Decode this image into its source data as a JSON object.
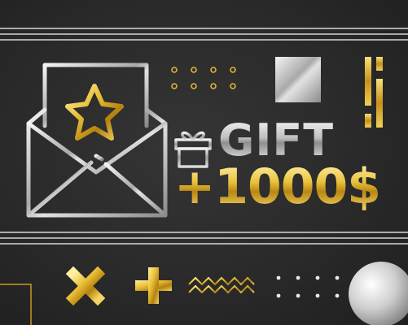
{
  "card": {
    "gift_label": "GIFT",
    "amount_label": "+1000$"
  },
  "colors": {
    "background": "#2a2a2a",
    "gold": "#e4b63a",
    "silver": "#c9c9c9"
  },
  "icons": [
    "envelope-icon",
    "star-icon",
    "gift-box-icon",
    "cross-icon",
    "plus-icon",
    "zigzag-icon",
    "dots-grid-icon",
    "silver-square",
    "gold-bars",
    "silver-circle"
  ]
}
